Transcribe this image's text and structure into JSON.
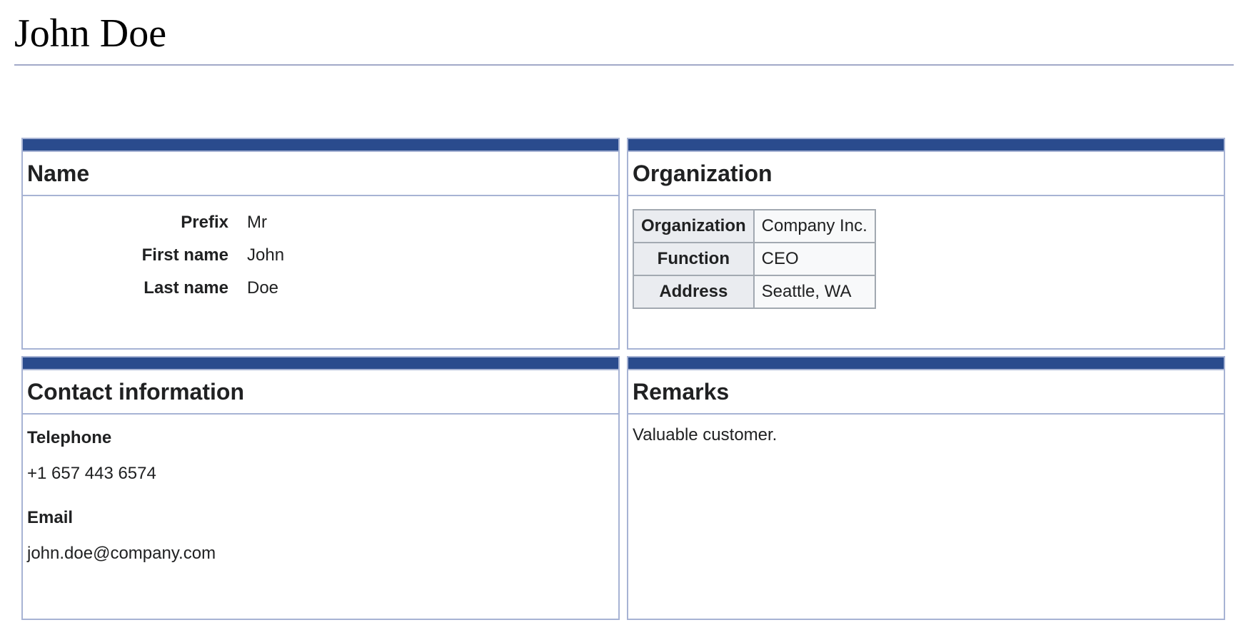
{
  "page": {
    "title": "John Doe"
  },
  "panels": {
    "name": {
      "heading": "Name",
      "fields": [
        {
          "label": "Prefix",
          "value": "Mr"
        },
        {
          "label": "First name",
          "value": "John"
        },
        {
          "label": "Last name",
          "value": "Doe"
        }
      ]
    },
    "organization": {
      "heading": "Organization",
      "rows": [
        {
          "label": "Organization",
          "value": "Company Inc."
        },
        {
          "label": "Function",
          "value": "CEO"
        },
        {
          "label": "Address",
          "value": "Seattle, WA"
        }
      ]
    },
    "contact": {
      "heading": "Contact information",
      "telephone_label": "Telephone",
      "telephone_value": "+1 657 443 6574",
      "email_label": "Email",
      "email_value": "john.doe@company.com"
    },
    "remarks": {
      "heading": "Remarks",
      "text": "Valuable customer."
    }
  },
  "colors": {
    "panel_bar": "#2a4b8d",
    "panel_border": "#a7b3d4",
    "table_key_bg": "#eaecf0",
    "table_val_bg": "#f8f9fa"
  }
}
